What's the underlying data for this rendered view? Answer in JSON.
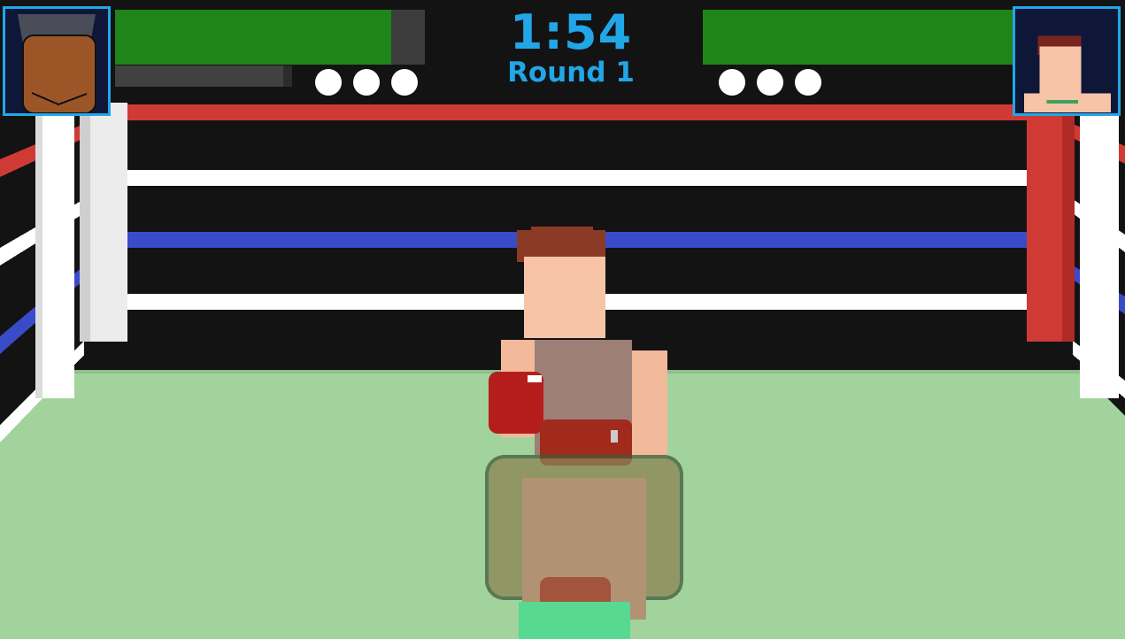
{
  "hud": {
    "timer": "1:54",
    "round_label": "Round 1",
    "player": {
      "health_fraction": 0.89,
      "stamina_fraction": 0.95,
      "knockdown_tokens": 3,
      "health_color": "#1f8519",
      "portrait_icon": "dark-skinned-boxer-portrait-icon"
    },
    "opponent": {
      "health_fraction": 1.0,
      "knockdown_tokens": 3,
      "health_color": "#1f8519",
      "portrait_icon": "brown-haired-boxer-portrait-icon"
    },
    "accent_color": "#22a6e8"
  },
  "ring": {
    "mat_color": "#a2d39d",
    "rope_colors": [
      "#d03a35",
      "#ffffff",
      "#3a4bc9",
      "#ffffff"
    ],
    "corner_post_colors": {
      "left": "#ececec",
      "right": "#d03a35"
    }
  }
}
